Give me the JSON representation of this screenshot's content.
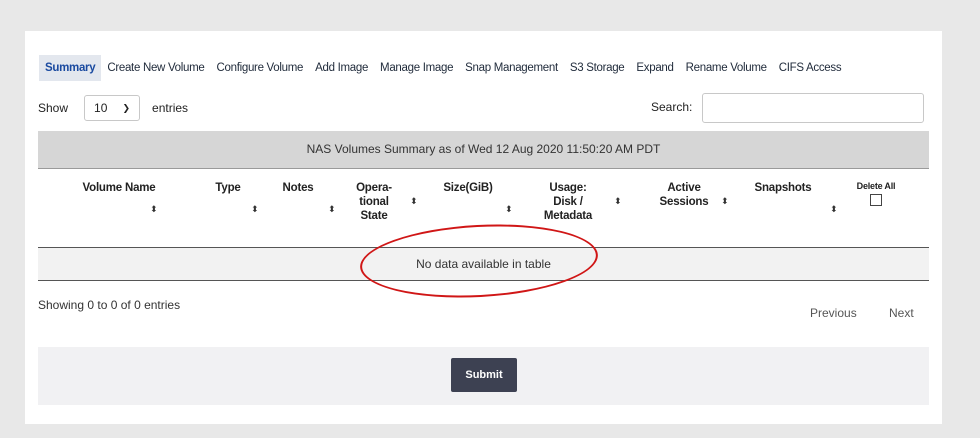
{
  "tabs": [
    {
      "label": "Summary",
      "active": true
    },
    {
      "label": "Create New Volume",
      "active": false
    },
    {
      "label": "Configure Volume",
      "active": false
    },
    {
      "label": "Add Image",
      "active": false
    },
    {
      "label": "Manage Image",
      "active": false
    },
    {
      "label": "Snap Management",
      "active": false
    },
    {
      "label": "S3 Storage",
      "active": false
    },
    {
      "label": "Expand",
      "active": false
    },
    {
      "label": "Rename Volume",
      "active": false
    },
    {
      "label": "CIFS Access",
      "active": false
    }
  ],
  "length": {
    "show_label": "Show",
    "selected": "10",
    "entries_label": "entries"
  },
  "search": {
    "label": "Search:",
    "value": ""
  },
  "table": {
    "caption": "NAS Volumes Summary as of Wed 12 Aug 2020 11:50:20 AM PDT",
    "columns": {
      "volume_name": "Volume Name",
      "type": "Type",
      "notes": "Notes",
      "op_state_1": "Opera-",
      "op_state_2": "tional",
      "op_state_3": "State",
      "size": "Size(GiB)",
      "usage_1": "Usage:",
      "usage_2": "Disk /",
      "usage_3": "Metadata",
      "active_1": "Active",
      "active_2": "Sessions",
      "snapshots": "Snapshots",
      "delete_all": "Delete All"
    },
    "empty_message": "No data available in table"
  },
  "info": "Showing 0 to 0 of 0 entries",
  "pagination": {
    "previous": "Previous",
    "next": "Next"
  },
  "footer": {
    "submit_label": "Submit"
  },
  "colors": {
    "annotation": "#d01616",
    "active_tab_text": "#1a4aa0",
    "submit_bg": "#3d4152"
  }
}
